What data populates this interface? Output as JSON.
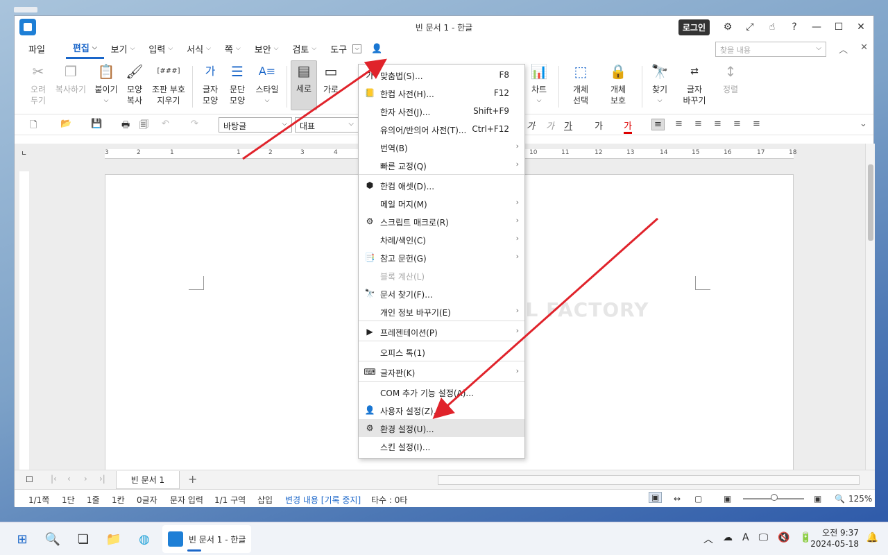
{
  "window": {
    "title": "빈 문서 1 - 한글",
    "login": "로그인"
  },
  "menubar": {
    "file": "파일",
    "tabs": [
      {
        "label": "편집"
      },
      {
        "label": "보기"
      },
      {
        "label": "입력"
      },
      {
        "label": "서식"
      },
      {
        "label": "쪽"
      },
      {
        "label": "보안"
      },
      {
        "label": "검토"
      },
      {
        "label": "도구"
      }
    ],
    "search_placeholder": "찾을 내용"
  },
  "ribbon": {
    "cut": "오려\n두기",
    "copy": "복사하기",
    "paste": "붙이기",
    "format_copy": "모양\n복사",
    "clear_code": "조판 부호\n지우기",
    "char_shape": "글자\n모양",
    "para_shape": "문단\n모양",
    "style": "스타일",
    "vertical": "세로",
    "horizontal": "가로",
    "chart": "차트",
    "select_obj": "개체\n선택",
    "protect_obj": "개체\n보호",
    "find": "찾기",
    "replace": "글자\n바꾸기",
    "sort": "정렬",
    "clear_code_sym": "[###]"
  },
  "toolbar": {
    "style_combo": "바탕글",
    "font_combo": "대표"
  },
  "tools_menu": {
    "items": [
      {
        "label": "맞춤법(S)...",
        "shortcut": "F8"
      },
      {
        "label": "한컴 사전(H)...",
        "shortcut": "F12"
      },
      {
        "label": "한자 사전(J)...",
        "shortcut": "Shift+F9"
      },
      {
        "label": "유의어/반의어 사전(T)...",
        "shortcut": "Ctrl+F12"
      },
      {
        "label": "번역(B)"
      },
      {
        "label": "빠른 교정(Q)"
      },
      {
        "label": "한컴 애셋(D)..."
      },
      {
        "label": "메일 머지(M)"
      },
      {
        "label": "스크립트 매크로(R)"
      },
      {
        "label": "차례/색인(C)"
      },
      {
        "label": "참고 문헌(G)"
      },
      {
        "label": "블록 계산(L)"
      },
      {
        "label": "문서 찾기(F)..."
      },
      {
        "label": "개인 정보 바꾸기(E)"
      },
      {
        "label": "프레젠테이션(P)"
      },
      {
        "label": "오피스 톡(1)"
      },
      {
        "label": "글자판(K)"
      },
      {
        "label": "COM 추가 기능 설정(A)..."
      },
      {
        "label": "사용자 설정(Z)..."
      },
      {
        "label": "환경 설정(U)..."
      },
      {
        "label": "스킨 설정(I)..."
      }
    ]
  },
  "watermark": "MANUAL FACTORY",
  "doc_tab": "빈 문서 1",
  "status": {
    "page": "1/1쪽",
    "col": "1단",
    "line": "1줄",
    "chr": "1칸",
    "count": "0글자",
    "mode": "문자 입력",
    "section": "1/1 구역",
    "insert": "삽입",
    "track": "변경 내용 [기록 중지]",
    "keystrokes": "타수 : 0타",
    "zoom": "125%"
  },
  "taskbar": {
    "app": "빈 문서 1 - 한글",
    "time": "오전 9:37",
    "date": "2024-05-18"
  },
  "ruler_numbers": [
    "3",
    "2",
    "1",
    "1",
    "2",
    "3",
    "4",
    "10",
    "11",
    "12",
    "13",
    "14",
    "15",
    "16",
    "17",
    "18"
  ],
  "colors": {
    "accent": "#1a66c9",
    "arrow": "#e0232b"
  }
}
